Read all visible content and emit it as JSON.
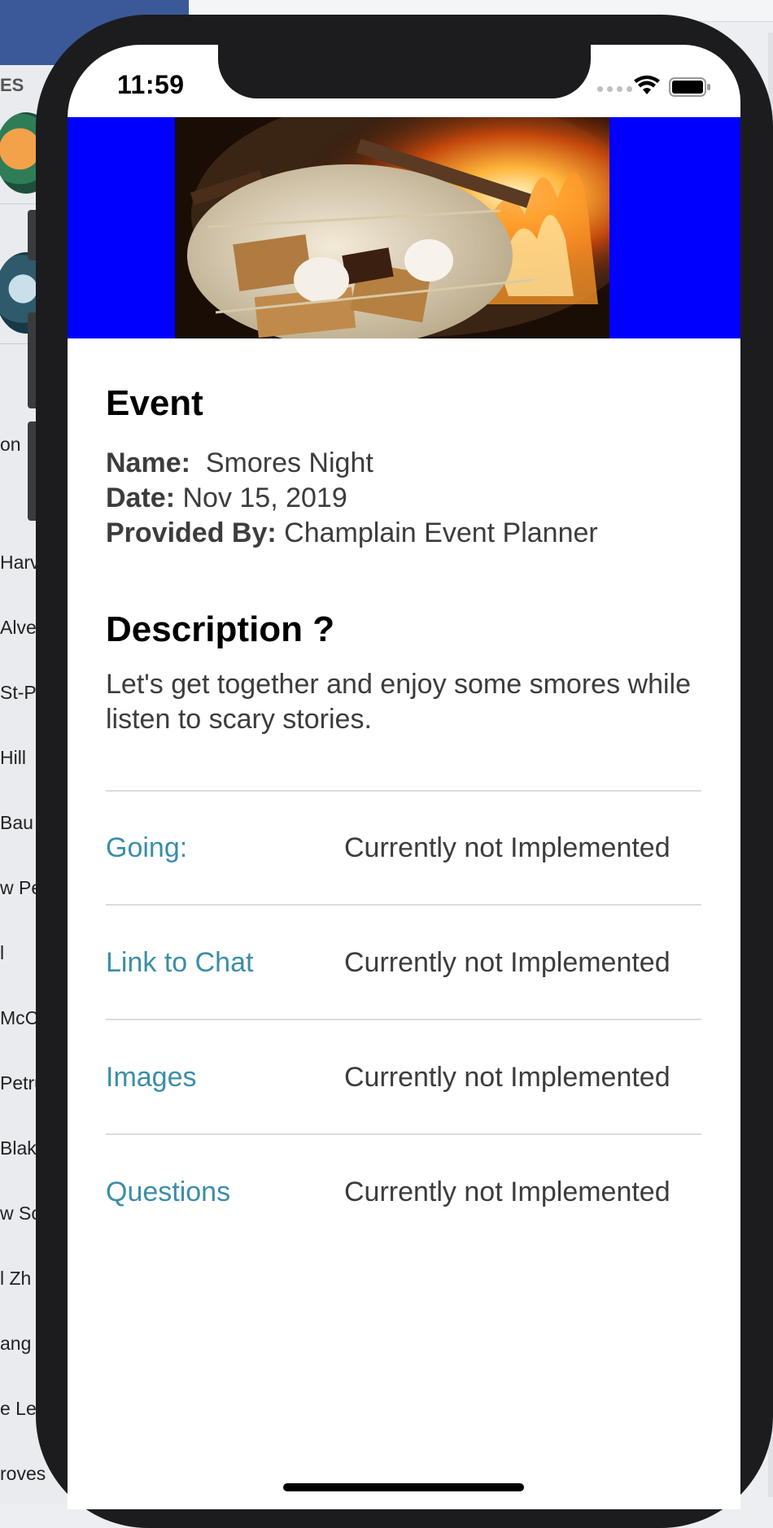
{
  "background_app": {
    "section_label": "ES",
    "names": [
      "on",
      "Harv",
      "Alve",
      "St-Pi",
      "Hill",
      "Bau",
      "w Pe",
      "l",
      "McC",
      "Petru",
      "Blak",
      "w Sc",
      "l Zh",
      "ang",
      "e Le",
      "roves"
    ]
  },
  "status_bar": {
    "time": "11:59",
    "wifi_icon": "wifi-icon",
    "battery_icon": "battery-icon"
  },
  "hero": {
    "background_color": "#0000ff",
    "image_subject": "smores-fire-image"
  },
  "event": {
    "heading": "Event",
    "name_label": "Name:",
    "name_value": "Smores Night",
    "date_label": "Date:",
    "date_value": "Nov 15, 2019",
    "provider_label": "Provided By:",
    "provider_value": "Champlain Event Planner"
  },
  "description": {
    "heading": "Description ?",
    "text": "Let's get together and enjoy some smores while listen to scary stories."
  },
  "rows": [
    {
      "label": "Going:",
      "value": "Currently not Implemented"
    },
    {
      "label": "Link to Chat",
      "value": "Currently not Implemented"
    },
    {
      "label": "Images",
      "value": "Currently not Implemented"
    },
    {
      "label": "Questions",
      "value": "Currently not Implemented"
    }
  ],
  "colors": {
    "link": "#3a8ea8",
    "text": "#3c3c3c",
    "hero_bg": "#0000ff",
    "phone_frame": "#1c1c1e"
  }
}
